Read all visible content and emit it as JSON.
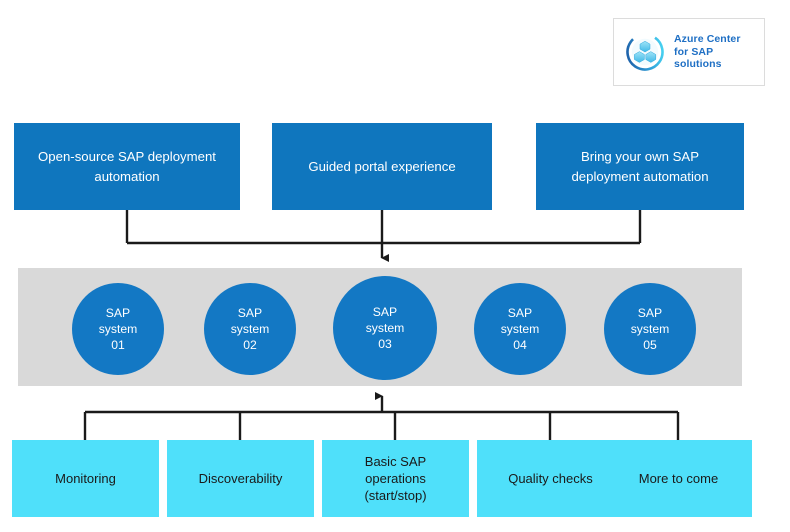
{
  "logo": {
    "icon": "azure-center-sap-cubes-icon",
    "line1": "Azure Center",
    "line2": "for SAP",
    "line3": "solutions"
  },
  "colors": {
    "primary_blue": "#0F76BE",
    "circle_blue": "#1378C4",
    "band_gray": "#D9D9D9",
    "accent_cyan": "#4FE0FA",
    "connector_black": "#1A1A1A",
    "logo_text_blue": "#1E6FC4",
    "background": "#FFFFFF"
  },
  "top_row": {
    "boxes": [
      {
        "label": "Open-source SAP deployment automation"
      },
      {
        "label": "Guided portal experience"
      },
      {
        "label": "Bring your own SAP deployment automation"
      }
    ]
  },
  "systems_band": {
    "circles": [
      {
        "label": "SAP system 01",
        "line1": "SAP",
        "line2": "system",
        "line3": "01"
      },
      {
        "label": "SAP system 02",
        "line1": "SAP",
        "line2": "system",
        "line3": "02"
      },
      {
        "label": "SAP system 03",
        "line1": "SAP",
        "line2": "system",
        "line3": "03"
      },
      {
        "label": "SAP system 04",
        "line1": "SAP",
        "line2": "system",
        "line3": "04"
      },
      {
        "label": "SAP system 05",
        "line1": "SAP",
        "line2": "system",
        "line3": "05"
      }
    ]
  },
  "bottom_row": {
    "boxes": [
      {
        "label": "Monitoring",
        "line1": "Monitoring",
        "line2": "",
        "line3": ""
      },
      {
        "label": "Discoverability",
        "line1": "Discoverability",
        "line2": "",
        "line3": ""
      },
      {
        "label": "Basic SAP operations (start/stop)",
        "line1": "Basic SAP",
        "line2": "operations",
        "line3": "(start/stop)"
      },
      {
        "label": "Quality checks",
        "line1": "Quality  checks",
        "line2": "",
        "line3": ""
      },
      {
        "label": "More to come",
        "line1": "More to come",
        "line2": "",
        "line3": ""
      }
    ]
  },
  "connectors": {
    "top_to_band": "downward-arrow",
    "bottom_to_band": "upward-arrow"
  }
}
